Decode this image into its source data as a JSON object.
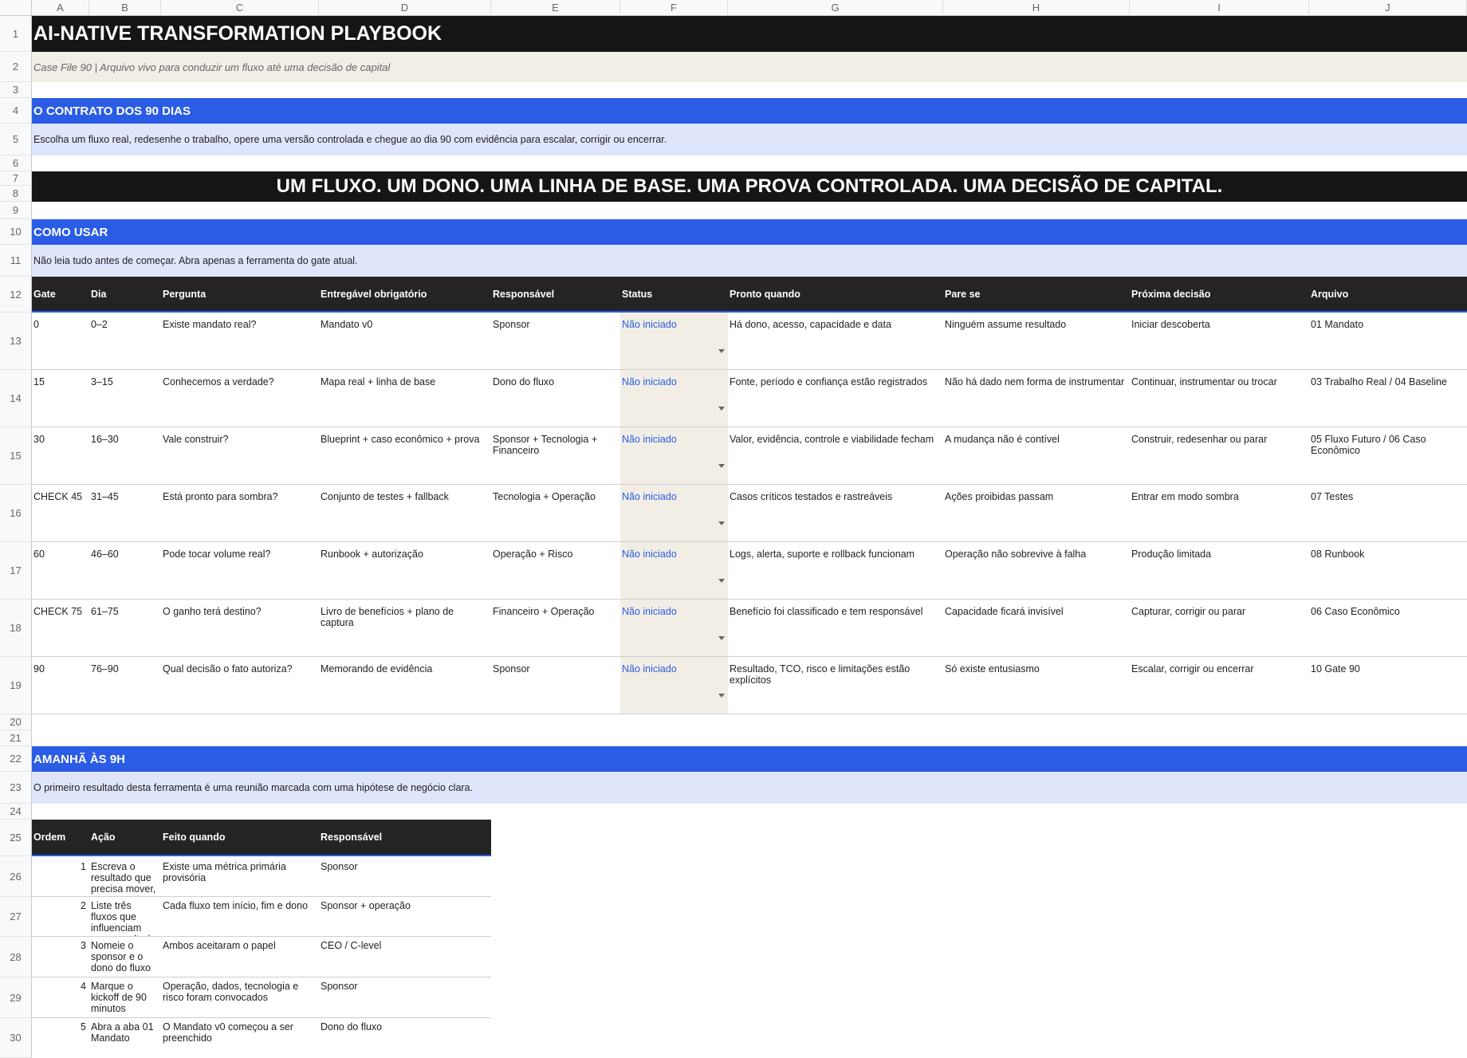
{
  "columns": [
    "A",
    "B",
    "C",
    "D",
    "E",
    "F",
    "G",
    "H",
    "I",
    "J"
  ],
  "rows": [
    "1",
    "2",
    "3",
    "4",
    "5",
    "6",
    "7",
    "8",
    "9",
    "10",
    "11",
    "12",
    "13",
    "14",
    "15",
    "16",
    "17",
    "18",
    "19",
    "20",
    "21",
    "22",
    "23",
    "24",
    "25",
    "26",
    "27",
    "28",
    "29",
    "30"
  ],
  "title": "AI-NATIVE TRANSFORMATION PLAYBOOK",
  "subtitle": "Case File 90 | Arquivo vivo para conduzir um fluxo até uma decisão de capital",
  "contract": {
    "heading": "O CONTRATO DOS 90 DIAS",
    "text": "Escolha um fluxo real, redesenhe o trabalho, opere uma versão controlada e chegue ao dia 90 com evidência para escalar, corrigir ou encerrar."
  },
  "banner": "UM FLUXO. UM DONO. UMA LINHA DE BASE. UMA PROVA CONTROLADA. UMA DECISÃO DE CAPITAL.",
  "how_to": {
    "heading": "COMO USAR",
    "text": "Não leia tudo antes de começar. Abra apenas a ferramenta do gate atual."
  },
  "gates_table": {
    "headers": [
      "Gate",
      "Dia",
      "Pergunta",
      "Entregável obrigatório",
      "Responsável",
      "Status",
      "Pronto quando",
      "Pare se",
      "Próxima decisão",
      "Arquivo"
    ],
    "rows": [
      [
        "0",
        "0–2",
        "Existe mandato real?",
        "Mandato v0",
        "Sponsor",
        "Não iniciado",
        "Há dono, acesso, capacidade e data",
        "Ninguém assume resultado",
        "Iniciar descoberta",
        "01 Mandato"
      ],
      [
        "15",
        "3–15",
        "Conhecemos a verdade?",
        "Mapa real + linha de base",
        "Dono do fluxo",
        "Não iniciado",
        "Fonte, período e confiança estão registrados",
        "Não há dado nem forma de instrumentar",
        "Continuar, instrumentar ou trocar",
        "03 Trabalho Real / 04 Baseline"
      ],
      [
        "30",
        "16–30",
        "Vale construir?",
        "Blueprint + caso econômico + prova",
        "Sponsor + Tecnologia + Financeiro",
        "Não iniciado",
        "Valor, evidência, controle e viabilidade fecham",
        "A mudança não é contível",
        "Construir, redesenhar ou parar",
        "05 Fluxo Futuro / 06 Caso Econômico"
      ],
      [
        "CHECK 45",
        "31–45",
        "Está pronto para sombra?",
        "Conjunto de testes + fallback",
        "Tecnologia + Operação",
        "Não iniciado",
        "Casos críticos testados e rastreáveis",
        "Ações proibidas passam",
        "Entrar em modo sombra",
        "07 Testes"
      ],
      [
        "60",
        "46–60",
        "Pode tocar volume real?",
        "Runbook + autorização",
        "Operação + Risco",
        "Não iniciado",
        "Logs, alerta, suporte e rollback funcionam",
        "Operação não sobrevive à falha",
        "Produção limitada",
        "08 Runbook"
      ],
      [
        "CHECK 75",
        "61–75",
        "O ganho terá destino?",
        "Livro de benefícios + plano de captura",
        "Financeiro + Operação",
        "Não iniciado",
        "Benefício foi classificado e tem responsável",
        "Capacidade ficará invisível",
        "Capturar, corrigir ou parar",
        "06 Caso Econômico"
      ],
      [
        "90",
        "76–90",
        "Qual decisão o fato autoriza?",
        "Memorando de evidência",
        "Sponsor",
        "Não iniciado",
        "Resultado, TCO, risco e limitações estão explícitos",
        "Só existe entusiasmo",
        "Escalar, corrigir ou encerrar",
        "10 Gate 90"
      ]
    ]
  },
  "tomorrow": {
    "heading": "AMANHÃ ÀS 9H",
    "text": "O primeiro resultado desta ferramenta é uma reunião marcada com uma hipótese de negócio clara."
  },
  "actions_table": {
    "headers": [
      "Ordem",
      "Ação",
      "Feito quando",
      "Responsável"
    ],
    "rows": [
      [
        "1",
        "Escreva o resultado que precisa mover, sem mencionar",
        "Existe uma métrica primária provisória",
        "Sponsor"
      ],
      [
        "2",
        "Liste três fluxos que influenciam esse resultado",
        "Cada fluxo tem início, fim e dono",
        "Sponsor + operação"
      ],
      [
        "3",
        "Nomeie o sponsor e o dono do fluxo",
        "Ambos aceitaram o papel",
        "CEO / C-level"
      ],
      [
        "4",
        "Marque o kickoff de 90 minutos",
        "Operação, dados, tecnologia e risco foram convocados",
        "Sponsor"
      ],
      [
        "5",
        "Abra a aba 01 Mandato",
        "O Mandato v0 começou a ser preenchido",
        "Dono do fluxo"
      ]
    ]
  }
}
